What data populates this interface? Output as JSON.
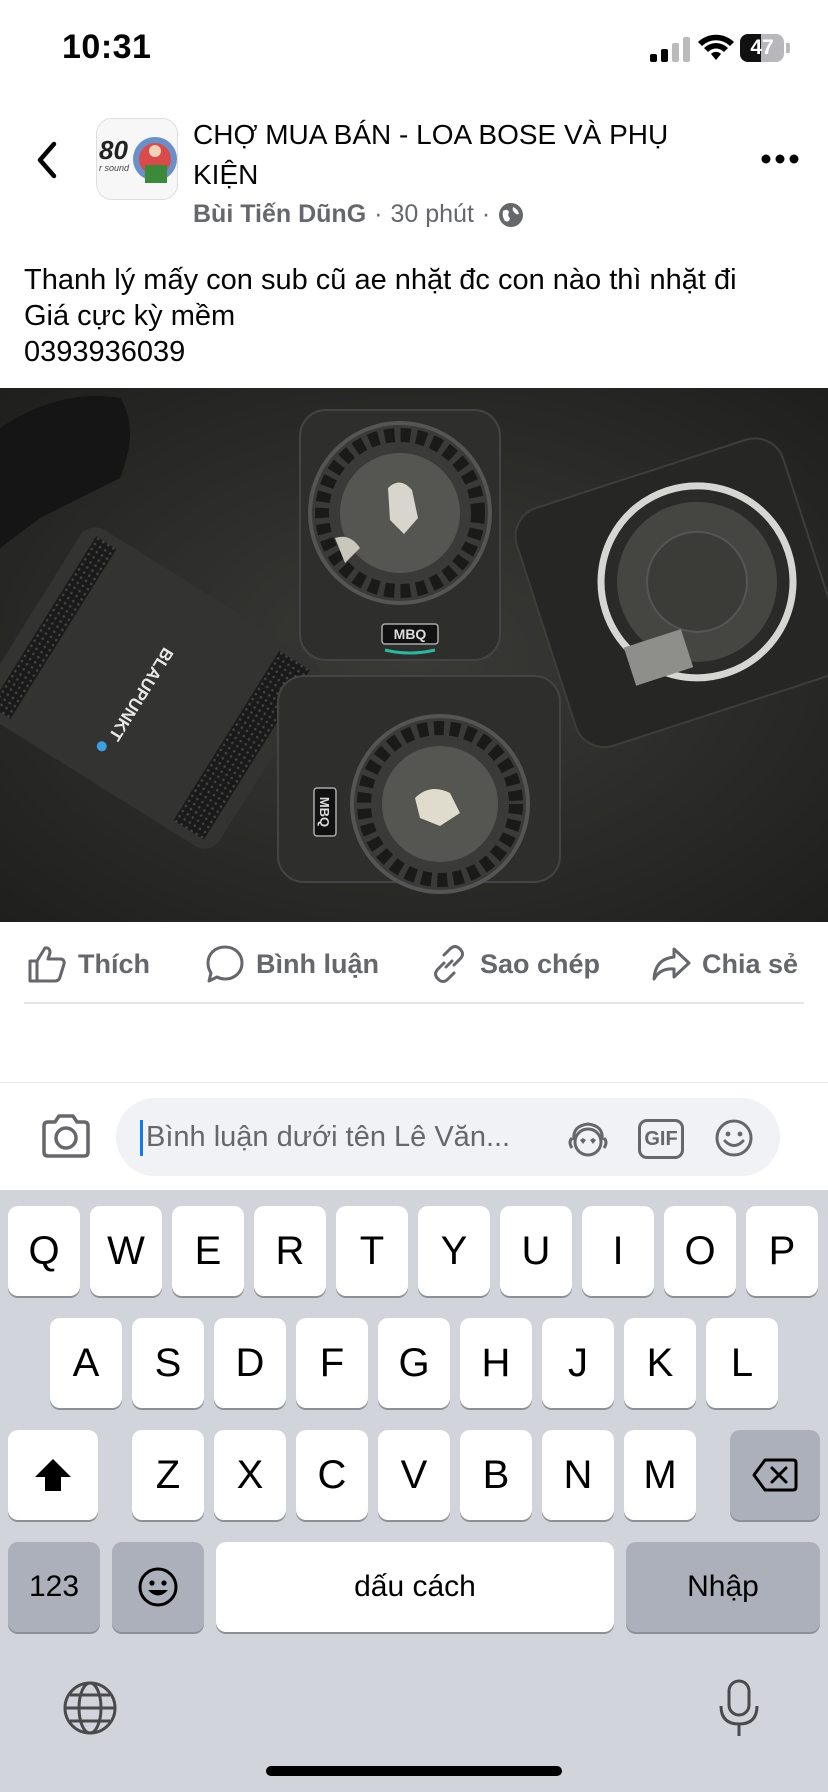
{
  "status_bar": {
    "time": "10:31",
    "battery": "47",
    "battery_level": 0.47
  },
  "header": {
    "group_name": "CHỢ MUA BÁN - LOA BOSE VÀ PHỤ KIỆN",
    "author": "Bùi Tiến DũnG",
    "time_ago": "30 phút",
    "separator": "·",
    "avatar_text": "80"
  },
  "post": {
    "lines": [
      "Thanh lý mấy con sub cũ ae nhặt đc con nào thì nhặt đi",
      "Giá cực kỳ mềm",
      "0393936039"
    ]
  },
  "photo": {
    "labels": [
      "BLAUPUNKT",
      "MBQ",
      "MBQ"
    ]
  },
  "actions": {
    "like": "Thích",
    "comment": "Bình luận",
    "copy": "Sao chép",
    "share": "Chia sẻ"
  },
  "comment_bar": {
    "placeholder": "Bình luận dưới tên Lê Văn...",
    "gif": "GIF"
  },
  "keyboard": {
    "row1": [
      "Q",
      "W",
      "E",
      "R",
      "T",
      "Y",
      "U",
      "I",
      "O",
      "P"
    ],
    "row2": [
      "A",
      "S",
      "D",
      "F",
      "G",
      "H",
      "J",
      "K",
      "L"
    ],
    "row3": [
      "Z",
      "X",
      "C",
      "V",
      "B",
      "N",
      "M"
    ],
    "numbers": "123",
    "space": "dấu cách",
    "enter": "Nhập"
  },
  "icons": {
    "back": "chevron-left-icon",
    "more": "more-dots-icon",
    "globe": "globe-icon",
    "like": "thumbs-up-icon",
    "comment": "comment-bubble-icon",
    "copy": "link-icon",
    "share": "share-arrow-icon",
    "camera": "camera-icon",
    "avatar_sticker": "avatar-sticker-icon",
    "gif": "gif-icon",
    "emoji": "emoji-icon",
    "shift": "shift-icon",
    "delete": "backspace-icon",
    "keyboard_emoji": "emoji-icon",
    "keyboard_globe": "globe-icon",
    "mic": "microphone-icon"
  },
  "colors": {
    "accent": "#1877f2",
    "secondary_text": "#65676b",
    "keyboard_bg": "#d1d4db"
  }
}
